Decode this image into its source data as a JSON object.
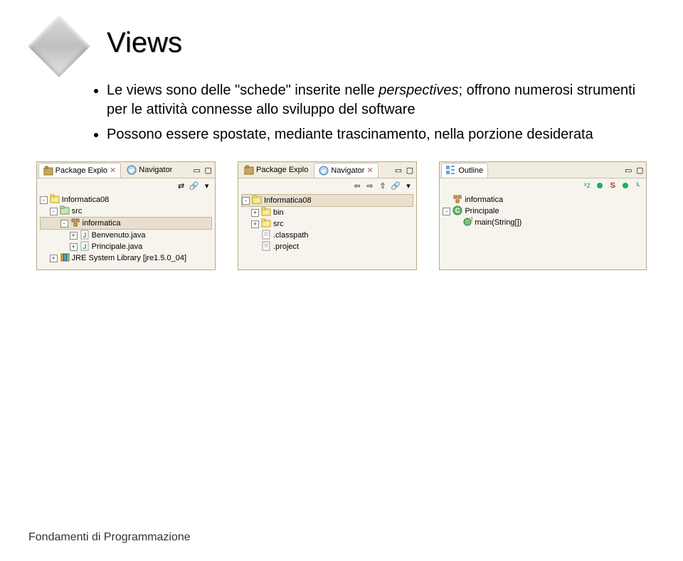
{
  "title": "Views",
  "bullets": [
    {
      "pre": "Le views sono delle \"schede\" inserite nelle ",
      "em": "perspectives",
      "post": "; offrono numerosi strumenti per le attività connesse allo sviluppo del software"
    },
    {
      "pre": "Possono essere spostate, mediante trascinamento, nella porzione desiderata",
      "em": "",
      "post": ""
    }
  ],
  "panel1": {
    "tabs": [
      {
        "icon": "package-explorer-icon",
        "label": "Package Explo",
        "active": true,
        "close": true
      },
      {
        "icon": "navigator-icon",
        "label": "Navigator",
        "active": false
      }
    ],
    "tree": [
      {
        "d": 0,
        "exp": "-",
        "icon": "project-icon",
        "label": "Informatica08"
      },
      {
        "d": 1,
        "exp": "-",
        "icon": "src-folder-icon",
        "label": "src"
      },
      {
        "d": 2,
        "exp": "-",
        "icon": "package-icon",
        "label": "informatica",
        "sel": true
      },
      {
        "d": 3,
        "exp": "+",
        "icon": "java-file-icon",
        "label": "Benvenuto.java"
      },
      {
        "d": 3,
        "exp": "+",
        "icon": "java-file-icon",
        "label": "Principale.java"
      },
      {
        "d": 1,
        "exp": "+",
        "icon": "library-icon",
        "label": "JRE System Library [jre1.5.0_04]"
      }
    ]
  },
  "panel2": {
    "tabs": [
      {
        "icon": "package-explorer-icon",
        "label": "Package Explo",
        "active": false
      },
      {
        "icon": "navigator-icon",
        "label": "Navigator",
        "active": true,
        "close": true
      }
    ],
    "tree": [
      {
        "d": 0,
        "exp": "-",
        "icon": "project-icon",
        "label": "Informatica08",
        "sel": true
      },
      {
        "d": 1,
        "exp": "+",
        "icon": "folder-icon",
        "label": "bin"
      },
      {
        "d": 1,
        "exp": "+",
        "icon": "folder-icon",
        "label": "src"
      },
      {
        "d": 1,
        "exp": " ",
        "icon": "file-icon",
        "label": ".classpath"
      },
      {
        "d": 1,
        "exp": " ",
        "icon": "file-icon",
        "label": ".project"
      }
    ]
  },
  "panel3": {
    "header": "Outline",
    "items": [
      {
        "d": 0,
        "exp": " ",
        "icon": "package-icon",
        "label": "informatica"
      },
      {
        "d": 0,
        "exp": "-",
        "icon": "class-icon",
        "label": "Principale"
      },
      {
        "d": 1,
        "exp": " ",
        "icon": "method-static-icon",
        "label": "main(String[])"
      }
    ],
    "sortIcons": [
      "sort-az-icon",
      "hide-fields-icon",
      "hide-static-icon",
      "hide-nonpublic-icon",
      "hide-local-icon"
    ]
  },
  "footer": "Fondamenti di Programmazione"
}
